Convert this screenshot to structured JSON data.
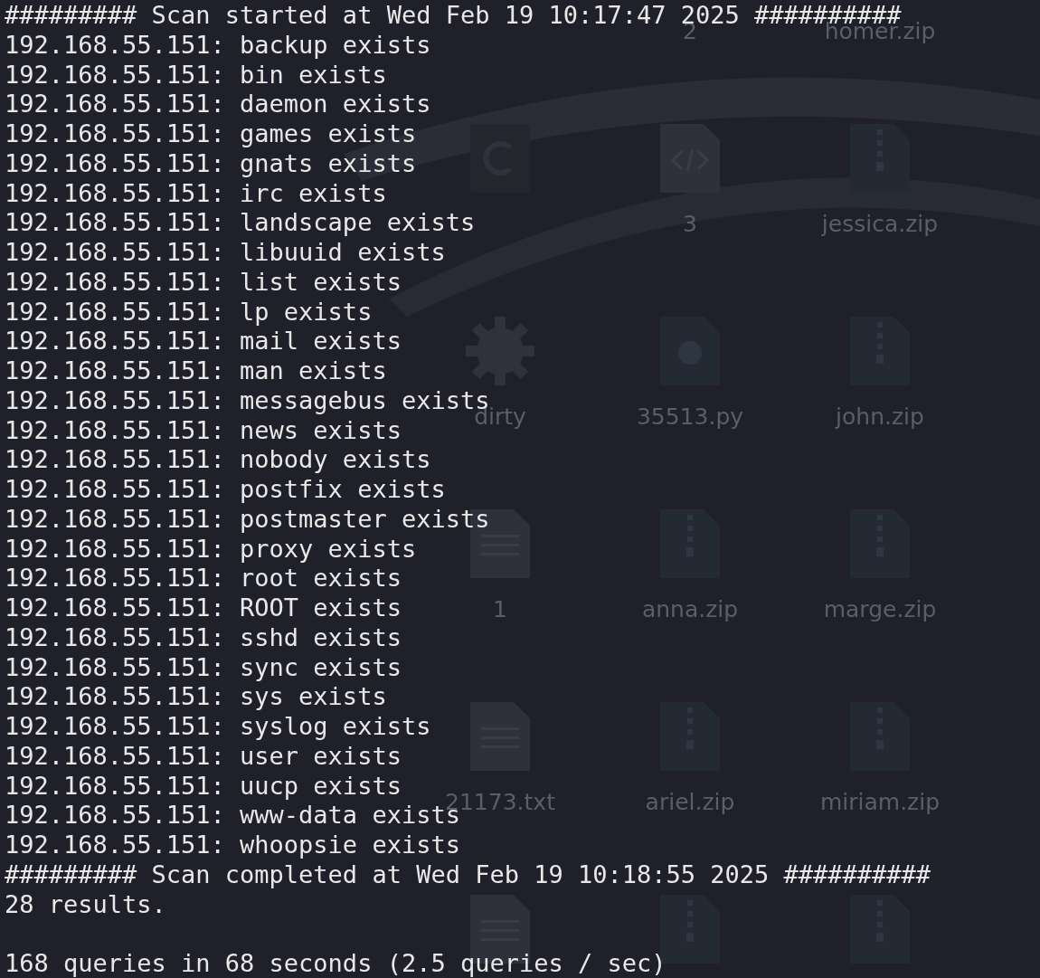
{
  "desktop": {
    "rows": [
      [
        null,
        {
          "label": "2"
        },
        {
          "label": "homer.zip"
        }
      ],
      [
        {
          "kind": "c"
        },
        {
          "kind": "code",
          "label": "3"
        },
        {
          "kind": "zip",
          "label": "jessica.zip"
        }
      ],
      [
        {
          "kind": "gear",
          "label": "dirty"
        },
        {
          "kind": "python",
          "label": "35513.py"
        },
        {
          "kind": "zip",
          "label": "john.zip"
        }
      ],
      [
        {
          "kind": "file",
          "label": "1"
        },
        {
          "kind": "zip",
          "label": "anna.zip"
        },
        {
          "kind": "zip",
          "label": "marge.zip"
        }
      ],
      [
        {
          "kind": "file",
          "label": "21173.txt"
        },
        {
          "kind": "zip",
          "label": "ariel.zip"
        },
        {
          "kind": "zip",
          "label": "miriam.zip"
        }
      ],
      [
        {
          "kind": "file"
        },
        {
          "kind": "zip"
        },
        {
          "kind": "zip"
        }
      ]
    ]
  },
  "terminal": {
    "lines": [
      "######### Scan started at Wed Feb 19 10:17:47 2025 ##########",
      "192.168.55.151: backup exists",
      "192.168.55.151: bin exists",
      "192.168.55.151: daemon exists",
      "192.168.55.151: games exists",
      "192.168.55.151: gnats exists",
      "192.168.55.151: irc exists",
      "192.168.55.151: landscape exists",
      "192.168.55.151: libuuid exists",
      "192.168.55.151: list exists",
      "192.168.55.151: lp exists",
      "192.168.55.151: mail exists",
      "192.168.55.151: man exists",
      "192.168.55.151: messagebus exists",
      "192.168.55.151: news exists",
      "192.168.55.151: nobody exists",
      "192.168.55.151: postfix exists",
      "192.168.55.151: postmaster exists",
      "192.168.55.151: proxy exists",
      "192.168.55.151: root exists",
      "192.168.55.151: ROOT exists",
      "192.168.55.151: sshd exists",
      "192.168.55.151: sync exists",
      "192.168.55.151: sys exists",
      "192.168.55.151: syslog exists",
      "192.168.55.151: user exists",
      "192.168.55.151: uucp exists",
      "192.168.55.151: www-data exists",
      "192.168.55.151: whoopsie exists",
      "######### Scan completed at Wed Feb 19 10:18:55 2025 ##########",
      "28 results."
    ],
    "stats": "168 queries in 68 seconds (2.5 queries / sec)"
  }
}
